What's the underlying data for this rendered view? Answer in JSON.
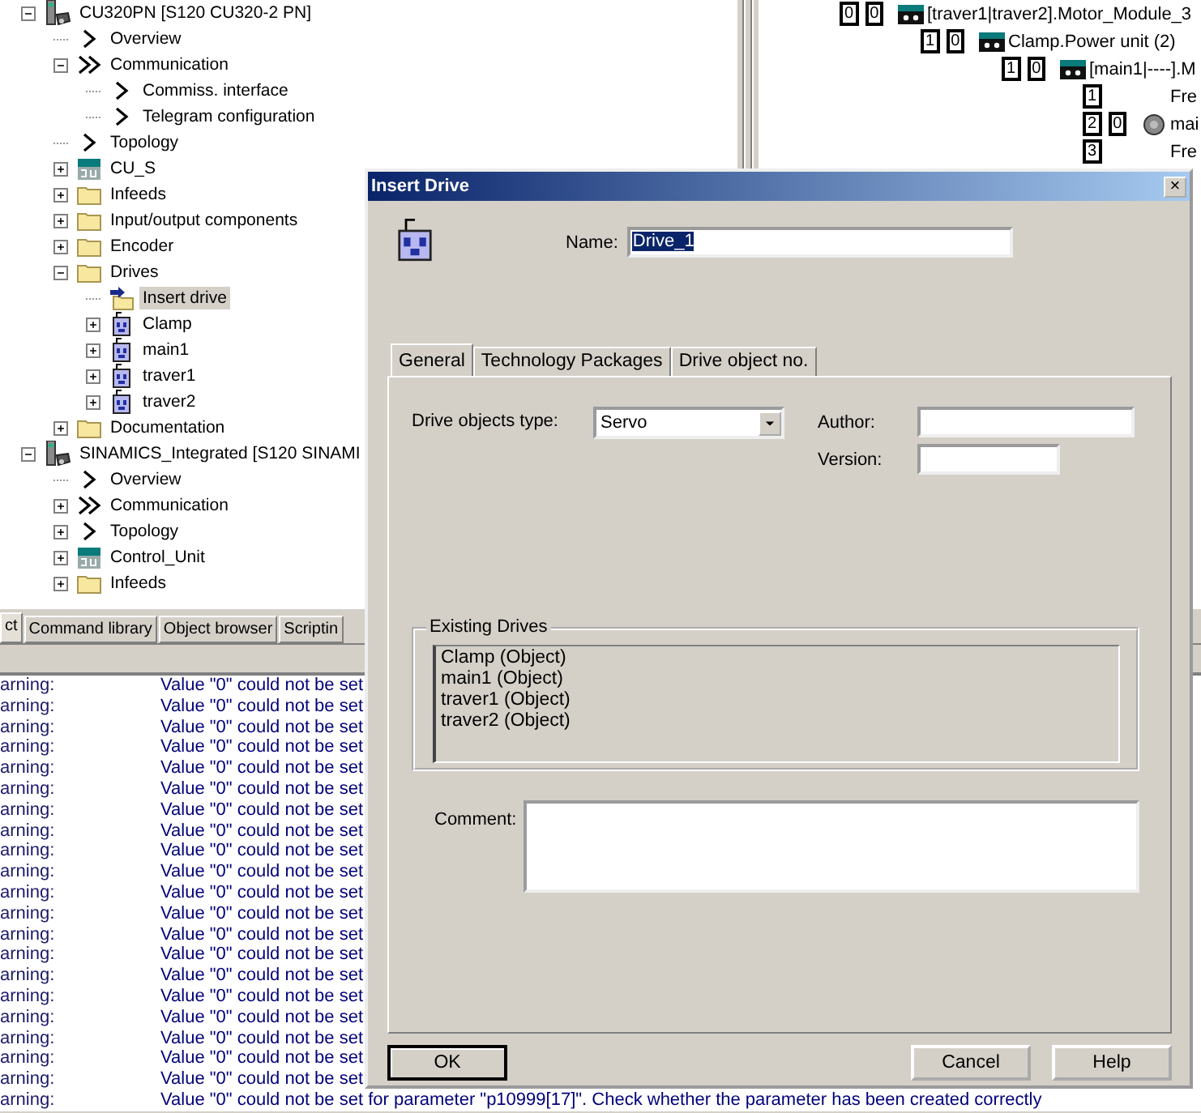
{
  "project_tree": [
    {
      "label": "CU320PN [S120 CU320-2 PN]",
      "kind": "device",
      "expanded": true,
      "selected": false,
      "children": [
        {
          "label": "Overview",
          "kind": "chevron",
          "selected": false
        },
        {
          "label": "Communication",
          "kind": "double-chevron",
          "expanded": true,
          "selected": false,
          "children": [
            {
              "label": "Commiss. interface",
              "kind": "chevron",
              "selected": false
            },
            {
              "label": "Telegram configuration",
              "kind": "chevron",
              "selected": false
            }
          ]
        },
        {
          "label": "Topology",
          "kind": "chevron",
          "selected": false
        },
        {
          "label": "CU_S",
          "kind": "cu",
          "expanded": false,
          "selected": false
        },
        {
          "label": "Infeeds",
          "kind": "folder",
          "expanded": false,
          "selected": false
        },
        {
          "label": "Input/output components",
          "kind": "folder",
          "expanded": false,
          "selected": false
        },
        {
          "label": "Encoder",
          "kind": "folder",
          "expanded": false,
          "selected": false
        },
        {
          "label": "Drives",
          "kind": "folder",
          "expanded": true,
          "selected": false,
          "children": [
            {
              "label": "Insert drive",
              "kind": "insert",
              "selected": true
            },
            {
              "label": "Clamp",
              "kind": "drive",
              "expanded": false,
              "selected": false
            },
            {
              "label": "main1",
              "kind": "drive",
              "expanded": false,
              "selected": false
            },
            {
              "label": "traver1",
              "kind": "drive",
              "expanded": false,
              "selected": false
            },
            {
              "label": "traver2",
              "kind": "drive",
              "expanded": false,
              "selected": false
            }
          ]
        },
        {
          "label": "Documentation",
          "kind": "folder",
          "expanded": false,
          "selected": false
        }
      ]
    },
    {
      "label": "SINAMICS_Integrated [S120 SINAMI",
      "kind": "device",
      "expanded": true,
      "selected": false,
      "children": [
        {
          "label": "Overview",
          "kind": "chevron",
          "selected": false
        },
        {
          "label": "Communication",
          "kind": "double-chevron",
          "expanded": false,
          "selected": false
        },
        {
          "label": "Topology",
          "kind": "chevron",
          "expanded": false,
          "selected": false
        },
        {
          "label": "Control_Unit",
          "kind": "cu",
          "expanded": false,
          "selected": false
        },
        {
          "label": "Infeeds",
          "kind": "folder",
          "expanded": false,
          "selected": false
        }
      ]
    }
  ],
  "topology_tree": [
    {
      "ports": [
        "0",
        "0"
      ],
      "kind": "module",
      "label": "[traver1|traver2].Motor_Module_3",
      "children": [
        {
          "ports": [
            "1",
            "0"
          ],
          "kind": "module",
          "label": "Clamp.Power unit (2)",
          "children": [
            {
              "ports": [
                "1",
                "0"
              ],
              "kind": "module",
              "label": "[main1|----].M",
              "children": [
                {
                  "ports": [
                    "1"
                  ],
                  "kind": "plain",
                  "label": "Fre"
                },
                {
                  "ports": [
                    "2",
                    "0"
                  ],
                  "kind": "motor",
                  "label": "mai"
                },
                {
                  "ports": [
                    "3"
                  ],
                  "kind": "plain",
                  "label": "Fre"
                }
              ]
            }
          ]
        }
      ]
    }
  ],
  "navigator_tabs": [
    {
      "label": "ct",
      "selected": true
    },
    {
      "label": "Command library",
      "selected": false
    },
    {
      "label": "Object browser",
      "selected": false
    },
    {
      "label": "Scriptin",
      "selected": false
    }
  ],
  "log": [
    {
      "type": "arning:",
      "message": "Value \"0\" could not be set"
    },
    {
      "type": "arning:",
      "message": "Value \"0\" could not be set"
    },
    {
      "type": "arning:",
      "message": "Value \"0\" could not be set"
    },
    {
      "type": "arning:",
      "message": "Value \"0\" could not be set"
    },
    {
      "type": "arning:",
      "message": "Value \"0\" could not be set"
    },
    {
      "type": "arning:",
      "message": "Value \"0\" could not be set"
    },
    {
      "type": "arning:",
      "message": "Value \"0\" could not be set"
    },
    {
      "type": "arning:",
      "message": "Value \"0\" could not be set"
    },
    {
      "type": "arning:",
      "message": "Value \"0\" could not be set"
    },
    {
      "type": "arning:",
      "message": "Value \"0\" could not be set"
    },
    {
      "type": "arning:",
      "message": "Value \"0\" could not be set"
    },
    {
      "type": "arning:",
      "message": "Value \"0\" could not be set"
    },
    {
      "type": "arning:",
      "message": "Value \"0\" could not be set"
    },
    {
      "type": "arning:",
      "message": "Value \"0\" could not be set"
    },
    {
      "type": "arning:",
      "message": "Value \"0\" could not be set"
    },
    {
      "type": "arning:",
      "message": "Value \"0\" could not be set"
    },
    {
      "type": "arning:",
      "message": "Value \"0\" could not be set"
    },
    {
      "type": "arning:",
      "message": "Value \"0\" could not be set"
    },
    {
      "type": "arning:",
      "message": "Value \"0\" could not be set"
    },
    {
      "type": "arning:",
      "message": "Value \"0\" could not be set"
    },
    {
      "type": "arning:",
      "message": "Value \"0\" could not be set for parameter \"p10999[17]\". Check whether the parameter has been created correctly"
    }
  ],
  "dialog": {
    "title": "Insert Drive",
    "close": "×",
    "name": {
      "label": "Name:",
      "value": "Drive_1",
      "value_selected": true
    },
    "tabs": [
      {
        "label": "General",
        "selected": true
      },
      {
        "label": "Technology Packages",
        "selected": false
      },
      {
        "label": "Drive object no.",
        "selected": false
      }
    ],
    "drive_type": {
      "label": "Drive objects type:",
      "value": "Servo"
    },
    "author": {
      "label": "Author:"
    },
    "version": {
      "label": "Version:"
    },
    "existing_drives": {
      "title": "Existing Drives",
      "items": [
        "Clamp (Object)",
        "main1 (Object)",
        "traver1 (Object)",
        "traver2 (Object)"
      ]
    },
    "comment": {
      "label": "Comment:"
    },
    "buttons": [
      {
        "label": "OK",
        "kind": "default"
      },
      {
        "label": "Cancel",
        "kind": "normal"
      },
      {
        "label": "Help",
        "kind": "normal"
      }
    ]
  }
}
